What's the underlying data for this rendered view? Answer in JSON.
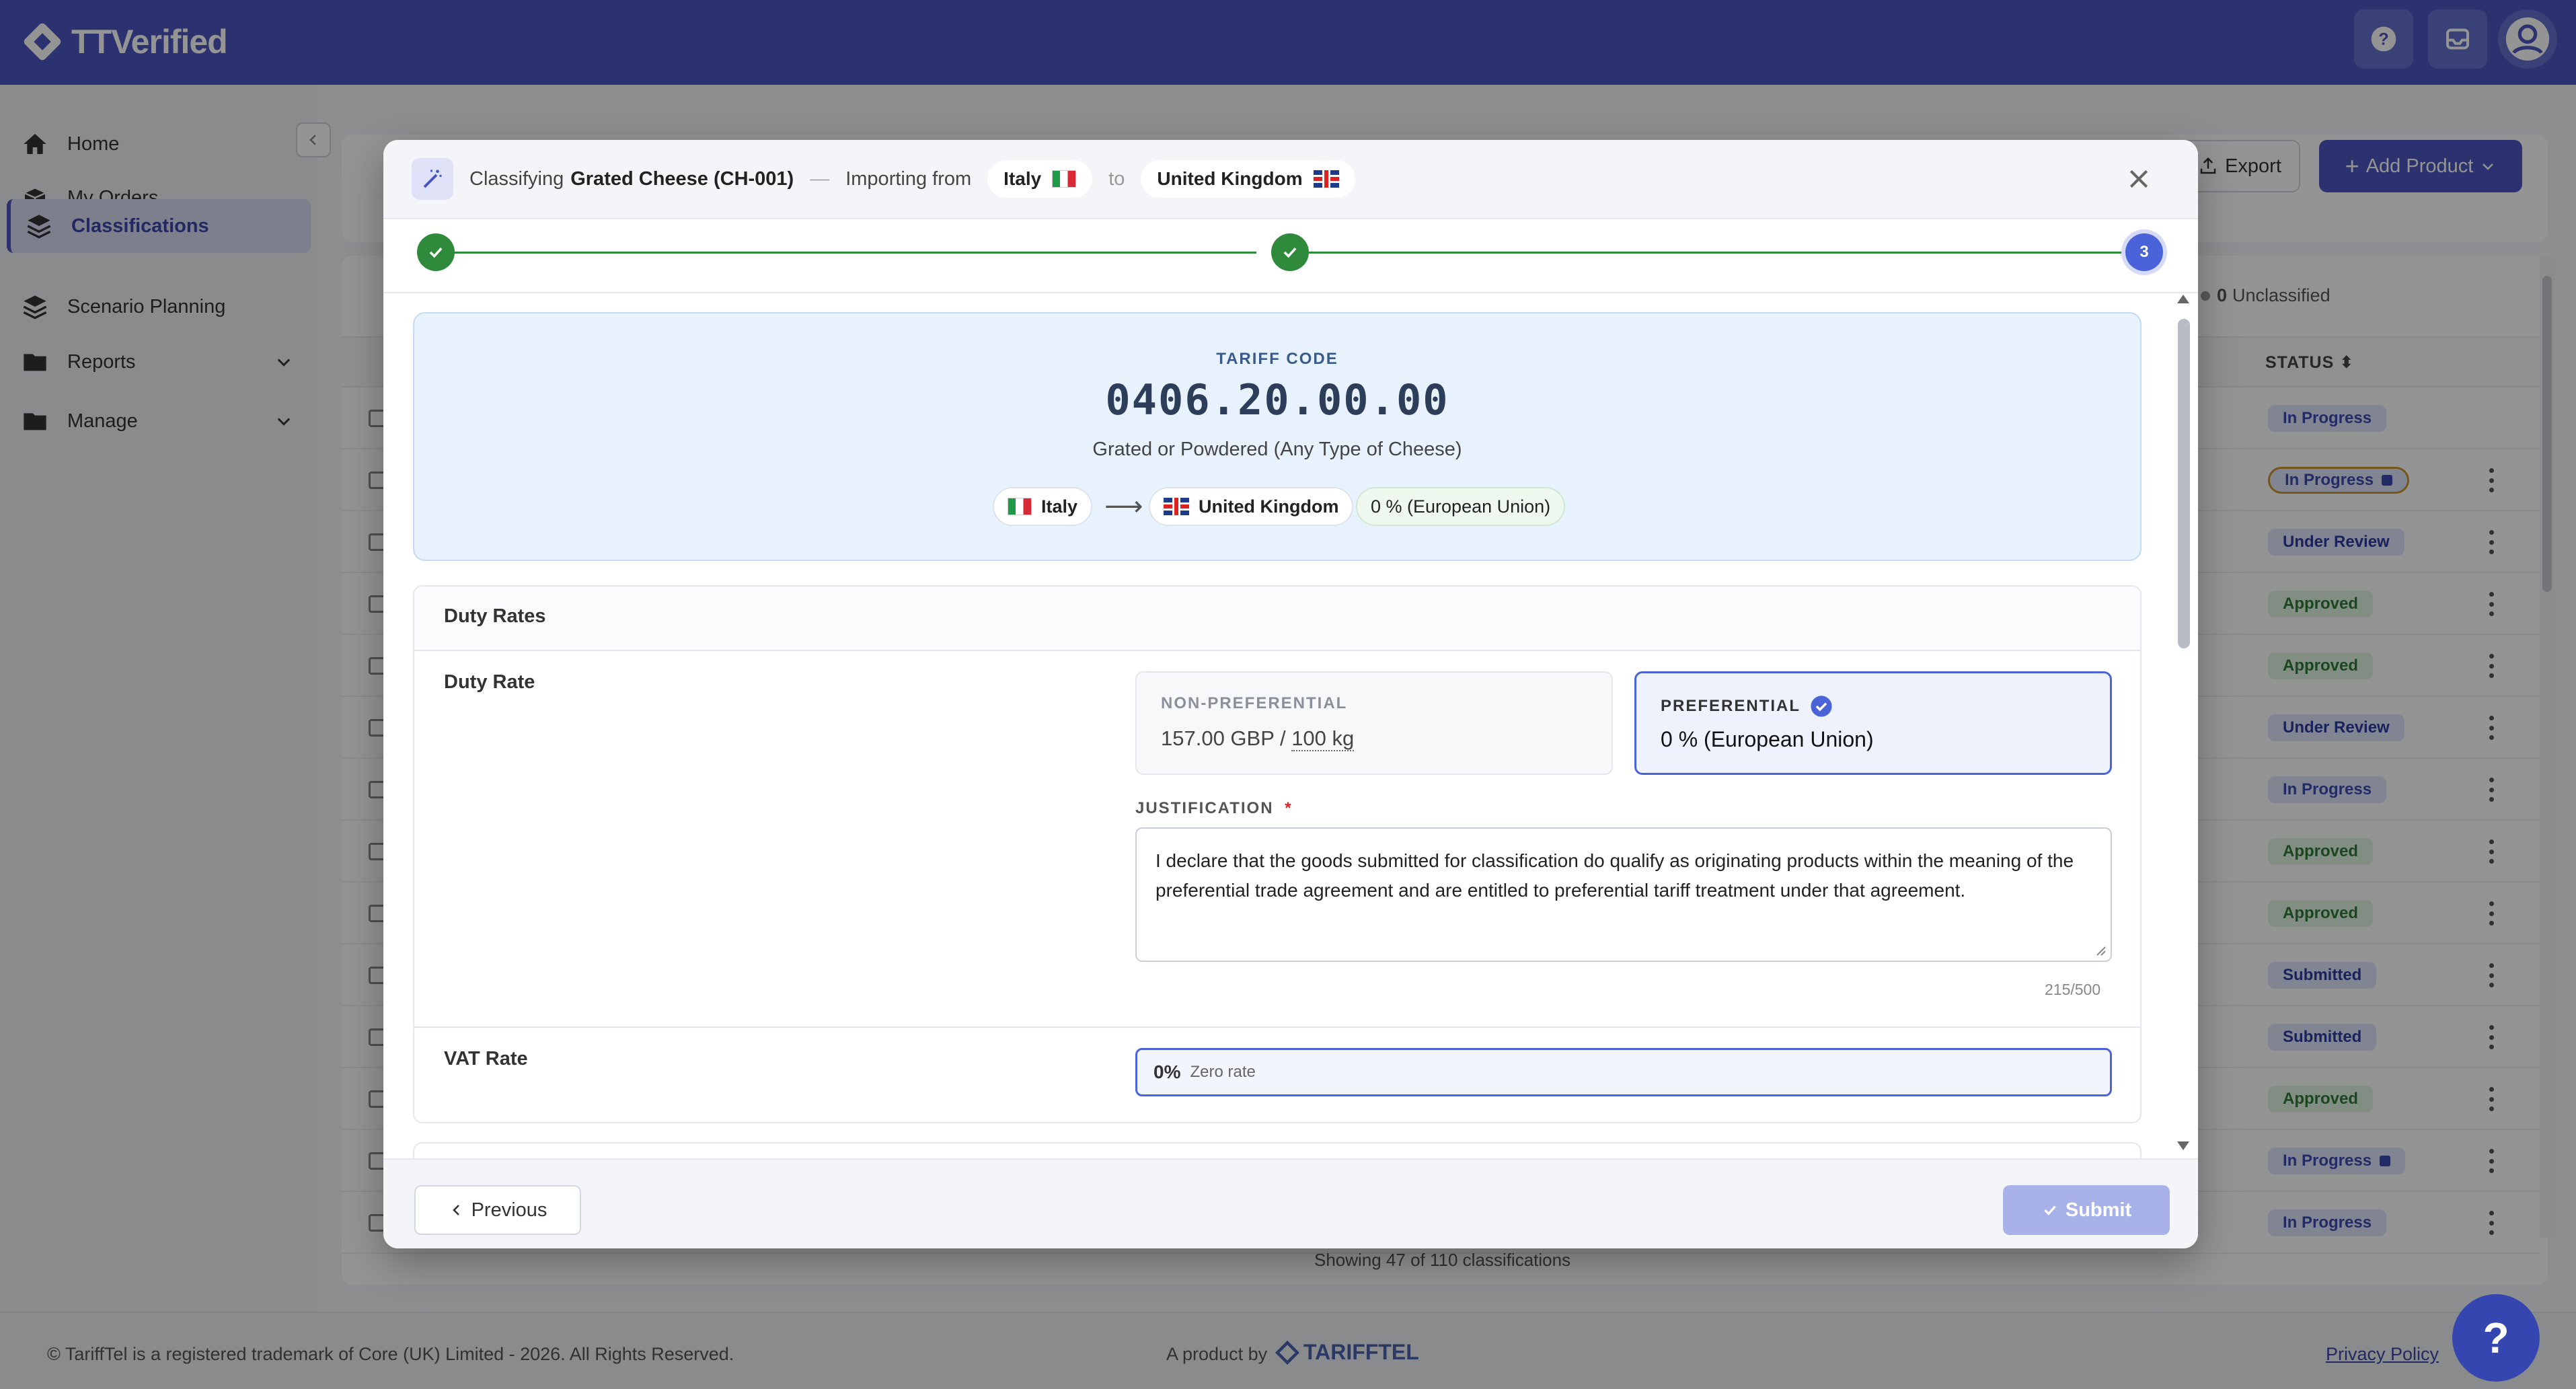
{
  "app": {
    "name": "TTVerified"
  },
  "sidebar": {
    "items": [
      {
        "label": "Home",
        "icon": "home-icon"
      },
      {
        "label": "My Orders",
        "icon": "orders-icon"
      },
      {
        "label": "Classifications",
        "icon": "layers-icon",
        "active": true
      },
      {
        "label": "Scenario Planning",
        "icon": "layers-icon"
      },
      {
        "label": "Reports",
        "icon": "folder-icon"
      },
      {
        "label": "Manage",
        "icon": "folder-icon"
      }
    ]
  },
  "page": {
    "export_label": "Export",
    "add_product_label": "Add Product",
    "unclassified_count": "0",
    "unclassified_label": "Unclassified",
    "status_header": "STATUS",
    "showing_text": "Showing 47 of 110 classifications",
    "rows": [
      {
        "status": "In Progress",
        "type": "prog"
      },
      {
        "status": "In Progress",
        "type": "prog-locked"
      },
      {
        "status": "Under Review",
        "type": "review"
      },
      {
        "status": "Approved",
        "type": "approved"
      },
      {
        "status": "Approved",
        "type": "approved"
      },
      {
        "status": "Under Review",
        "type": "review"
      },
      {
        "status": "In Progress",
        "type": "prog"
      },
      {
        "status": "Approved",
        "type": "approved"
      },
      {
        "status": "Approved",
        "type": "approved"
      },
      {
        "status": "Submitted",
        "type": "sub"
      },
      {
        "status": "Submitted",
        "type": "sub"
      },
      {
        "status": "Approved",
        "type": "approved"
      },
      {
        "status": "In Progress",
        "type": "prog-doc"
      },
      {
        "status": "In Progress",
        "type": "prog"
      }
    ]
  },
  "footer": {
    "copyright": "© TariffTel is a registered trademark of Core (UK) Limited - 2026. All Rights Reserved.",
    "product_by": "A product by",
    "brand": "TARIFFTEL",
    "privacy": "Privacy Policy"
  },
  "modal": {
    "classifying_prefix": "Classifying",
    "product": "Grated Cheese (CH-001)",
    "dash": "—",
    "importing_from": "Importing from",
    "origin": "Italy",
    "to": "to",
    "destination": "United Kingdom",
    "current_step": "3",
    "tariff": {
      "caption": "TARIFF CODE",
      "code": "0406.20.00.00",
      "description": "Grated or Powdered (Any Type of Cheese)",
      "origin": "Italy",
      "arrow": "⟶",
      "destination": "United Kingdom",
      "rate": "0 % (European Union)"
    },
    "duty": {
      "section_title": "Duty Rates",
      "label": "Duty Rate",
      "non_pref_caption": "NON-PREFERENTIAL",
      "non_pref_value": "157.00 GBP / ",
      "non_pref_unit": "100 kg",
      "pref_caption": "PREFERENTIAL",
      "pref_value": "0 % (European Union)",
      "justification_label": "JUSTIFICATION",
      "required_mark": "*",
      "justification_text": "I declare that the goods submitted for classification do qualify as originating products within the meaning of the preferential trade agreement and are entitled to preferential tariff treatment under that agreement.",
      "char_count": "215/500"
    },
    "vat": {
      "label": "VAT Rate",
      "value": "0%",
      "note": "Zero rate"
    },
    "previous_label": "Previous",
    "submit_label": "Submit"
  },
  "help_fab": "?",
  "colors": {
    "brand": "#4a56c0",
    "success": "#2f8a3c",
    "accent": "#4a63d8"
  }
}
